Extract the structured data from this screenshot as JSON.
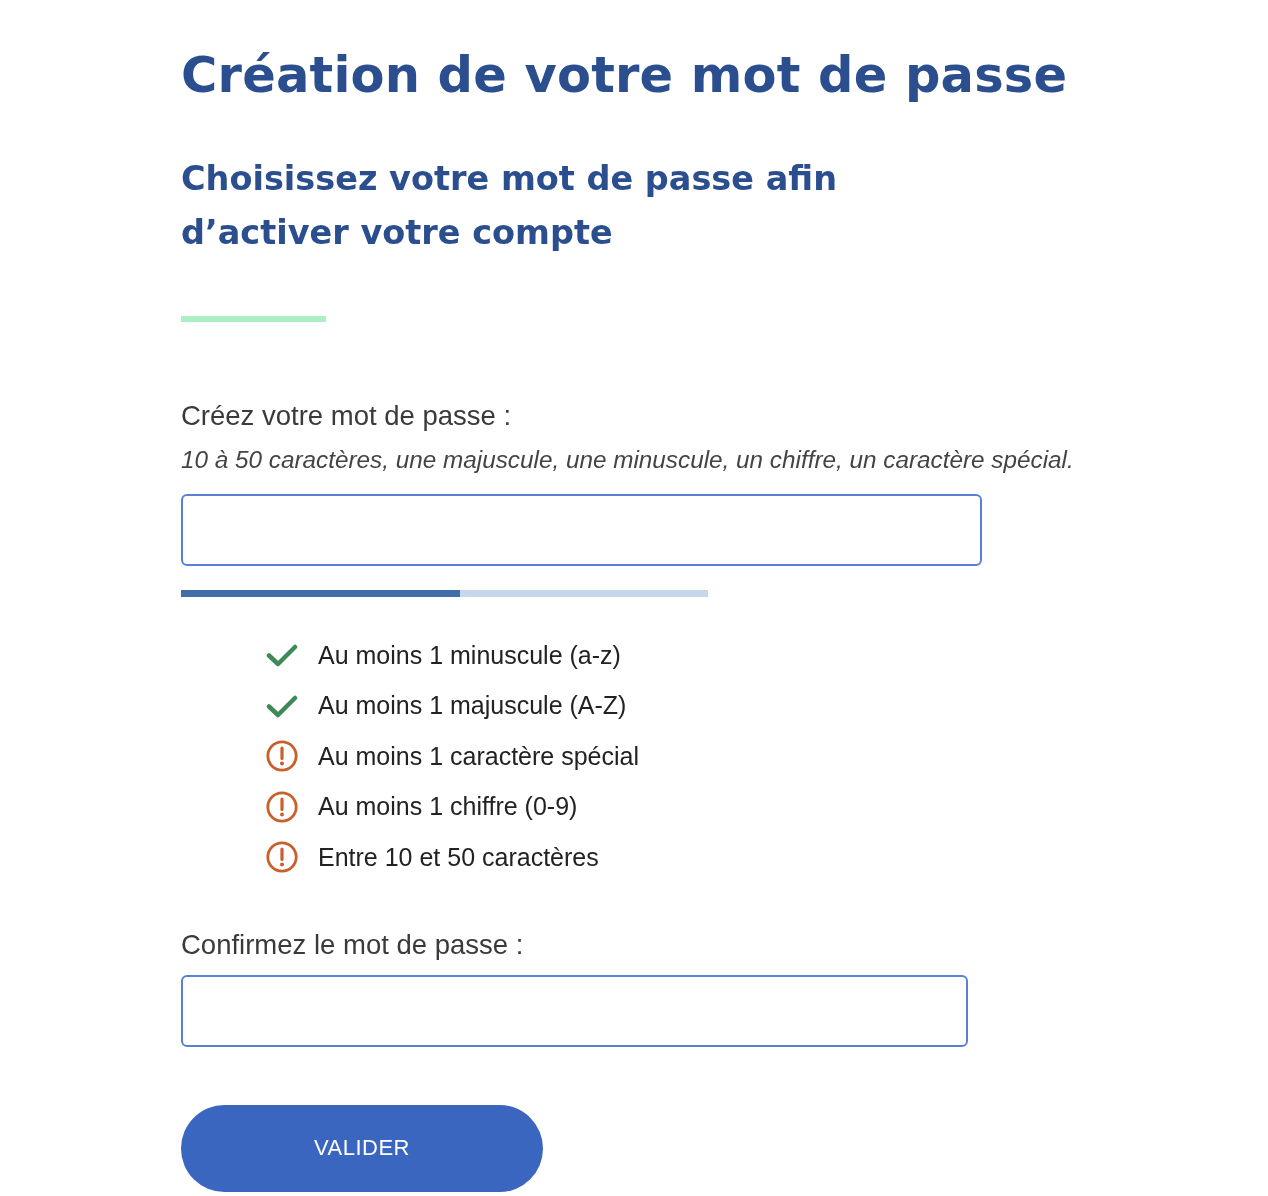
{
  "heading": {
    "title": "Création de votre mot de passe",
    "subtitle": "Choisissez votre mot de passe afin d’activer votre compte"
  },
  "password_field": {
    "label": "Créez votre mot de passe :",
    "hint": "10 à 50 caractères, une majuscule, une minuscule, un chiffre, un caractère spécial.",
    "strength": {
      "level": 0.53
    }
  },
  "requirements": [
    {
      "text": "Au moins 1 minuscule (a-z)",
      "met": true
    },
    {
      "text": "Au moins 1 majuscule (A-Z)",
      "met": true
    },
    {
      "text": "Au moins 1 caractère spécial",
      "met": false
    },
    {
      "text": "Au moins 1 chiffre (0-9)",
      "met": false
    },
    {
      "text": "Entre 10 et 50 caractères",
      "met": false
    }
  ],
  "confirm_field": {
    "label": "Confirmez le mot de passe :"
  },
  "submit_button": {
    "label": "VALIDER"
  }
}
